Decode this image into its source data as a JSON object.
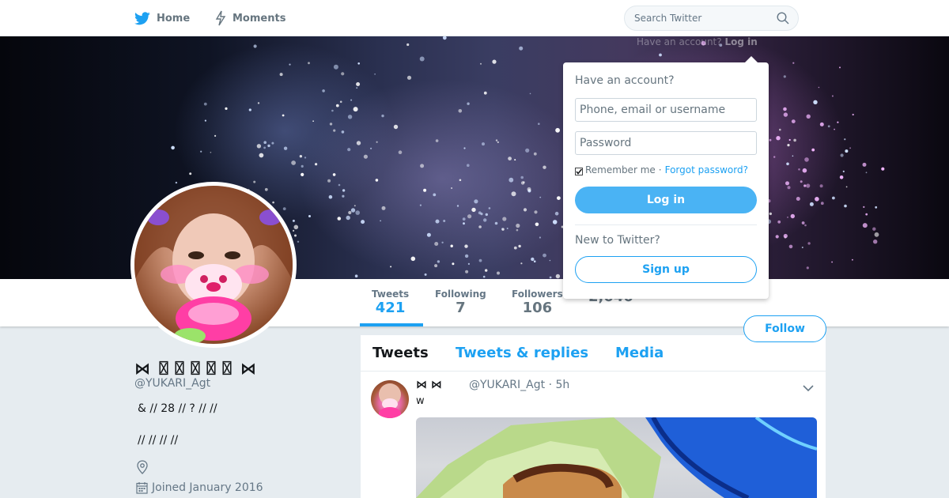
{
  "nav": {
    "home_label": "Home",
    "moments_label": "Moments",
    "search_placeholder": "Search Twitter",
    "have_account_text": "Have an account?",
    "have_account_login": "Log in"
  },
  "profile": {
    "name": "⋈ 〿〿〿〿〿 ⋈",
    "handle": "@YUKARI_Agt",
    "bio_line1": "&  // 28 // ? //  //",
    "bio_line2": "//  //  //  //",
    "joined": "Joined January 2016",
    "follow_label": "Follow"
  },
  "stats": [
    {
      "label": "Tweets",
      "value": "421"
    },
    {
      "label": "Following",
      "value": "7"
    },
    {
      "label": "Followers",
      "value": "106"
    },
    {
      "label": "",
      "value": "2,040"
    }
  ],
  "timeline": {
    "tabs": [
      "Tweets",
      "Tweets & replies",
      "Media"
    ],
    "tweet": {
      "name": "⋈  ⋈",
      "meta": "@YUKARI_Agt · 5h",
      "text": "w"
    }
  },
  "login_dropdown": {
    "heading": "Have an account?",
    "username_placeholder": "Phone, email or username",
    "password_placeholder": "Password",
    "remember_label": "Remember me",
    "separator": "·",
    "forgot_label": "Forgot password?",
    "login_label": "Log in",
    "new_label": "New to Twitter?",
    "signup_label": "Sign up"
  },
  "colors": {
    "accent": "#1da1f2",
    "login_button": "#4ab3f4",
    "background": "#e6ecf0"
  }
}
